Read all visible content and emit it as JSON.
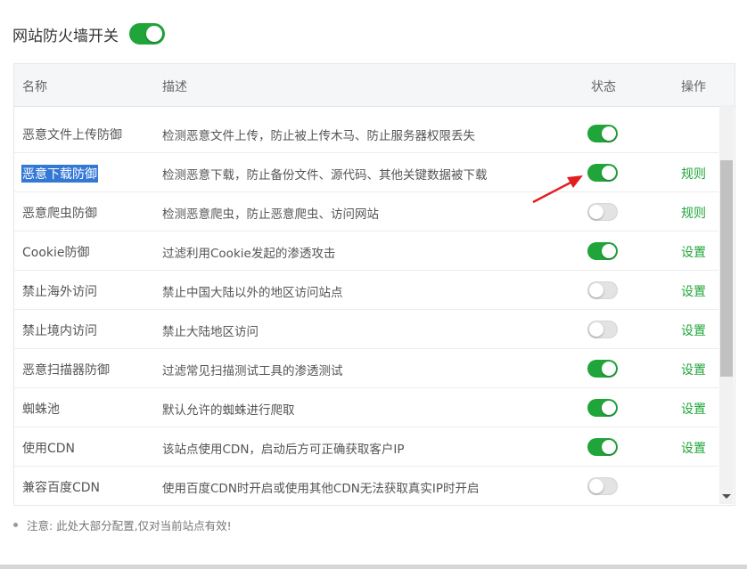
{
  "master": {
    "label": "网站防火墙开关",
    "enabled": true
  },
  "table": {
    "headers": {
      "name": "名称",
      "desc": "描述",
      "status": "状态",
      "op": "操作"
    },
    "rows": [
      {
        "name": "恶意文件上传防御",
        "desc": "检测恶意文件上传，防止被上传木马、防止服务器权限丢失",
        "on": true,
        "op": ""
      },
      {
        "name": "恶意下载防御",
        "desc": "检测恶意下载，防止备份文件、源代码、其他关键数据被下载",
        "on": true,
        "op": "规则",
        "selected": true
      },
      {
        "name": "恶意爬虫防御",
        "desc": "检测恶意爬虫，防止恶意爬虫、访问网站",
        "on": false,
        "op": "规则"
      },
      {
        "name": "Cookie防御",
        "desc": "过滤利用Cookie发起的渗透攻击",
        "on": true,
        "op": "设置"
      },
      {
        "name": "禁止海外访问",
        "desc": "禁止中国大陆以外的地区访问站点",
        "on": false,
        "op": "设置"
      },
      {
        "name": "禁止境内访问",
        "desc": "禁止大陆地区访问",
        "on": false,
        "op": "设置"
      },
      {
        "name": "恶意扫描器防御",
        "desc": "过滤常见扫描测试工具的渗透测试",
        "on": true,
        "op": "设置"
      },
      {
        "name": "蜘蛛池",
        "desc": "默认允许的蜘蛛进行爬取",
        "on": true,
        "op": "设置"
      },
      {
        "name": "使用CDN",
        "desc": "该站点使用CDN，启动后方可正确获取客户IP",
        "on": true,
        "op": "设置"
      },
      {
        "name": "兼容百度CDN",
        "desc": "使用百度CDN时开启或使用其他CDN无法获取真实IP时开启",
        "on": false,
        "op": ""
      }
    ]
  },
  "note": "注意: 此处大部分配置,仅对当前站点有效!",
  "colors": {
    "accent": "#20a53a",
    "selection": "#3478d6",
    "annotation_arrow": "#e02020"
  }
}
